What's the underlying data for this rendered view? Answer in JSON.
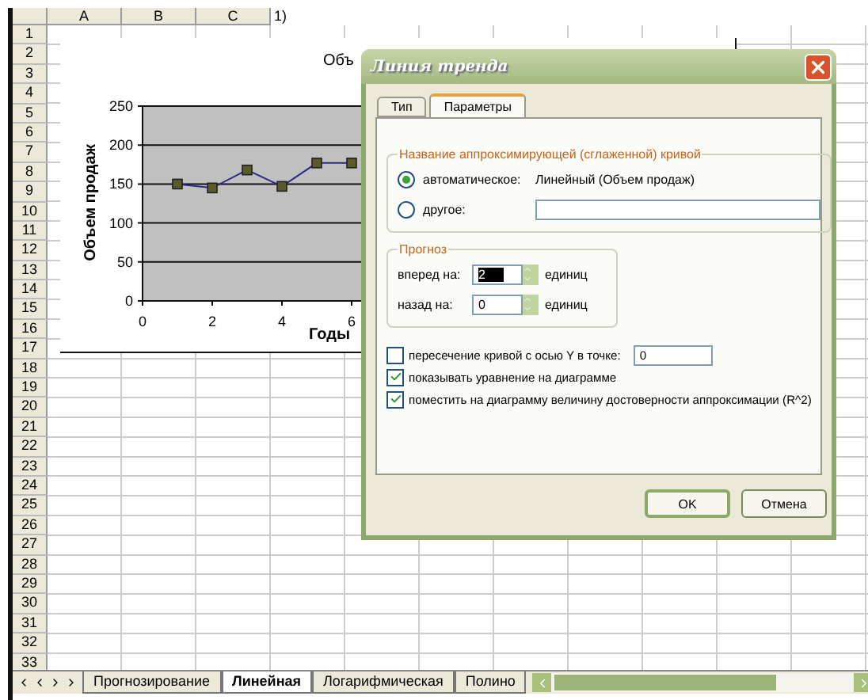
{
  "sheet": {
    "columns": [
      "A",
      "B",
      "C"
    ],
    "header_note": "1)",
    "rows": [
      "1",
      "2",
      "3",
      "4",
      "5",
      "6",
      "7",
      "8",
      "9",
      "10",
      "11",
      "12",
      "13",
      "14",
      "15",
      "16",
      "17",
      "18",
      "19",
      "20",
      "21",
      "22",
      "23",
      "24",
      "25",
      "26",
      "27",
      "28",
      "29",
      "30",
      "31",
      "32",
      "33"
    ]
  },
  "chart": {
    "title": "Объ",
    "chart_data": {
      "type": "line",
      "xlabel": "Годы",
      "ylabel": "Объем продаж",
      "x": [
        1,
        2,
        3,
        4,
        5,
        6
      ],
      "series": [
        {
          "color": "#2a2a8a",
          "marker": true,
          "values": [
            150,
            145,
            168,
            147,
            177,
            177
          ]
        }
      ],
      "grid": true,
      "xlim": [
        0,
        7
      ],
      "ylim": [
        0,
        250
      ],
      "xticks": [
        0,
        2,
        4,
        6
      ],
      "yticks": [
        0,
        50,
        100,
        150,
        200,
        250
      ]
    }
  },
  "dialog": {
    "title": "Линия тренда",
    "tabs": [
      {
        "label": "Тип",
        "selected": false
      },
      {
        "label": "Параметры",
        "selected": true
      }
    ],
    "name_group": {
      "legend": "Название аппроксимирующей (сглаженной) кривой",
      "options": [
        {
          "label": "автоматическое:",
          "selected": true,
          "value": "Линейный (Объем продаж)",
          "kind": "text"
        },
        {
          "label": "другое:",
          "selected": false,
          "kind": "field"
        }
      ]
    },
    "forecast_group": {
      "legend": "Прогноз",
      "rows": [
        {
          "label": "вперед на:",
          "value": "2",
          "highlighted": true,
          "unit": "единиц"
        },
        {
          "label": "назад на:",
          "value": "0",
          "highlighted": false,
          "unit": "единиц"
        }
      ]
    },
    "options": [
      {
        "label": "пересечение кривой с осью Y в точке:",
        "checked": false,
        "value": "0"
      },
      {
        "label": "показывать уравнение на диаграмме",
        "checked": true
      },
      {
        "label": "поместить на диаграмму величину достоверности аппроксимации (R^2)",
        "checked": true
      }
    ],
    "buttons": [
      {
        "label": "OK",
        "default": true
      },
      {
        "label": "Отмена",
        "default": false
      }
    ]
  },
  "sheet_tabs": [
    {
      "label": "Прогнозирование",
      "selected": false
    },
    {
      "label": "Линейная",
      "selected": true
    },
    {
      "label": "Логарифмическая",
      "selected": false
    },
    {
      "label": "Полино",
      "selected": false
    }
  ]
}
